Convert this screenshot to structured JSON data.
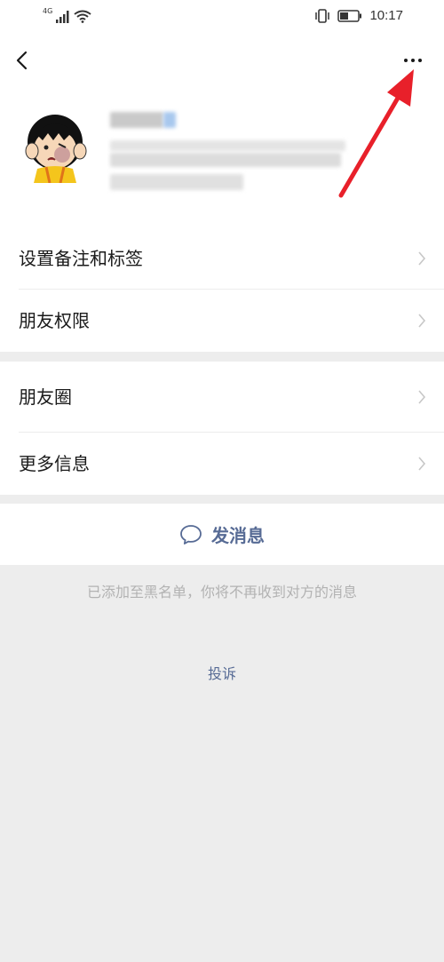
{
  "status_bar": {
    "network": "4G",
    "time": "10:17",
    "icons": [
      "signal-icon",
      "wifi-icon",
      "vibrate-icon",
      "battery-icon"
    ]
  },
  "header": {
    "back_icon": "chevron-left-icon",
    "more_icon": "more-dots-icon"
  },
  "profile": {
    "avatar": "cartoon-avatar",
    "name_redacted": true
  },
  "menu_group_1": [
    {
      "label": "设置备注和标签"
    },
    {
      "label": "朋友权限"
    }
  ],
  "menu_group_2": [
    {
      "label": "朋友圈"
    },
    {
      "label": "更多信息"
    }
  ],
  "send_message": {
    "label": "发消息",
    "icon": "chat-bubble-icon"
  },
  "blacklist_notice": "已添加至黑名单，你将不再收到对方的消息",
  "report_link": "投诉",
  "colors": {
    "background": "#ededed",
    "link": "#576b95",
    "annotation_arrow": "#e8202a"
  }
}
